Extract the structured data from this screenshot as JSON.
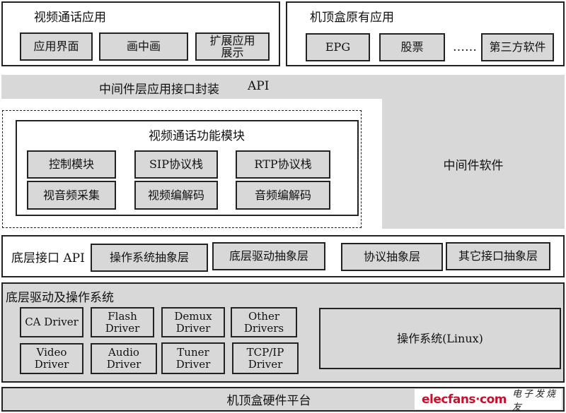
{
  "video_call_apps": {
    "title": "视频通话应用",
    "items": [
      "应用界面",
      "画中画",
      "扩展应用\n展示"
    ]
  },
  "stb_native_apps": {
    "title": "机顶盒原有应用",
    "items": [
      "EPG",
      "股票",
      "第三方软件"
    ],
    "ellipsis": "……"
  },
  "middleware_api_bar": {
    "label": "中间件层应用接口封装",
    "api": "API"
  },
  "middleware_software": {
    "label": "中间件软件"
  },
  "video_call_module": {
    "title": "视频通话功能模块",
    "items": [
      "控制模块",
      "SIP协议栈",
      "RTP协议栈",
      "视音频采集",
      "视频编解码",
      "音频编解码"
    ]
  },
  "low_level_api": {
    "label": "底层接口 API",
    "items": [
      "操作系统抽象层",
      "底层驱动抽象层",
      "协议抽象层",
      "其它接口抽象层"
    ]
  },
  "drivers_os": {
    "title": "底层驱动及操作系统",
    "drivers": [
      "CA Driver",
      "Flash Driver",
      "Demux\nDriver",
      "Other\nDrivers",
      "Video Driver",
      "Audio Driver",
      "Tuner\nDriver",
      "TCP/IP\nDriver"
    ],
    "os": "操作系统(Linux)"
  },
  "hardware": {
    "label": "机顶盒硬件平台"
  },
  "watermark": {
    "brand": "elecfans·com",
    "cn": "电子发烧友",
    "brand_color": "#c8102e"
  }
}
